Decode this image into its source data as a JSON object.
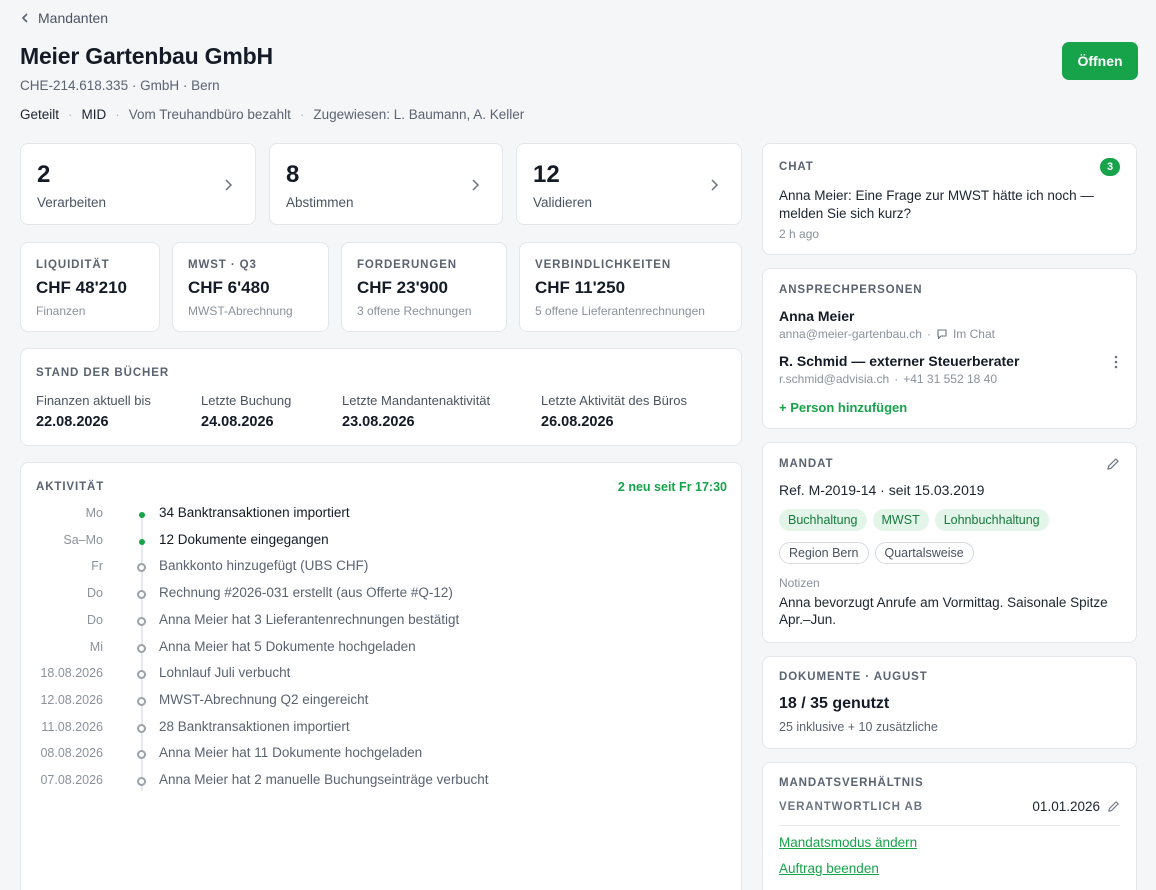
{
  "nav": {
    "back_label": "Mandanten"
  },
  "client": {
    "name": "Meier Gartenbau GmbH",
    "subtitle": "CHE-214.618.335 · GmbH · Bern",
    "meta": [
      "Geteilt",
      "MID",
      "Vom Treuhandbüro bezahlt",
      "Zugewiesen: L. Baumann, A. Keller"
    ],
    "open_label": "Öffnen"
  },
  "tasks": [
    {
      "count": "2",
      "label": "Verarbeiten"
    },
    {
      "count": "8",
      "label": "Abstimmen"
    },
    {
      "count": "12",
      "label": "Validieren"
    }
  ],
  "kpis": [
    {
      "caption": "LIQUIDITÄT",
      "value": "CHF 48'210",
      "sub": "Finanzen"
    },
    {
      "caption": "MWST · Q3",
      "value": "CHF 6'480",
      "sub": "MWST-Abrechnung"
    },
    {
      "caption": "FORDERUNGEN",
      "value": "CHF 23'900",
      "sub": "3 offene Rechnungen"
    },
    {
      "caption": "VERBINDLICHKEITEN",
      "value": "CHF 11'250",
      "sub": "5 offene Lieferantenrechnungen"
    }
  ],
  "books": {
    "caption": "STAND DER BÜCHER",
    "columns": [
      {
        "label": "Finanzen aktuell bis",
        "value": "22.08.2026"
      },
      {
        "label": "Letzte Buchung",
        "value": "24.08.2026"
      },
      {
        "label": "Letzte Mandantenaktivität",
        "value": "23.08.2026"
      },
      {
        "label": "Letzte Aktivität des Büros",
        "value": "26.08.2026"
      }
    ]
  },
  "activity": {
    "caption": "AKTIVITÄT",
    "new_label": "2 neu seit Fr 17:30",
    "items": [
      {
        "day": "Mo",
        "text": "34 Banktransaktionen importiert",
        "new": true
      },
      {
        "day": "Sa–Mo",
        "text": "12 Dokumente eingegangen",
        "new": true
      },
      {
        "day": "Fr",
        "text": "Bankkonto hinzugefügt (UBS CHF)",
        "new": false
      },
      {
        "day": "Do",
        "text": "Rechnung #2026-031 erstellt (aus Offerte #Q-12)",
        "new": false
      },
      {
        "day": "Do",
        "text": "Anna Meier hat 3 Lieferantenrechnungen bestätigt",
        "new": false
      },
      {
        "day": "Mi",
        "text": "Anna Meier hat 5 Dokumente hochgeladen",
        "new": false
      },
      {
        "day": "18.08.2026",
        "text": "Lohnlauf Juli verbucht",
        "new": false
      },
      {
        "day": "12.08.2026",
        "text": "MWST-Abrechnung Q2 eingereicht",
        "new": false
      },
      {
        "day": "11.08.2026",
        "text": "28 Banktransaktionen importiert",
        "new": false
      },
      {
        "day": "08.08.2026",
        "text": "Anna Meier hat 11 Dokumente hochgeladen",
        "new": false
      },
      {
        "day": "07.08.2026",
        "text": "Anna Meier hat 2 manuelle Buchungseinträge verbucht",
        "new": false
      }
    ]
  },
  "chat": {
    "caption": "CHAT",
    "badge": "3",
    "message": "Anna Meier: Eine Frage zur MWST hätte ich noch — melden Sie sich kurz?",
    "time": "2 h ago"
  },
  "contacts": {
    "caption": "ANSPRECHPERSONEN",
    "people": [
      {
        "name": "Anna Meier",
        "email": "anna@meier-gartenbau.ch",
        "extra": "Im Chat"
      },
      {
        "name": "R. Schmid — externer Steuerberater",
        "email": "r.schmid@advisia.ch",
        "extra": "+41 31 552 18 40"
      }
    ],
    "add_label": "+ Person hinzufügen"
  },
  "mandate": {
    "caption": "MANDAT",
    "ref": "Ref. M-2019-14 · seit 15.03.2019",
    "services": [
      "Buchhaltung",
      "MWST",
      "Lohnbuchhaltung"
    ],
    "attributes": [
      "Region Bern",
      "Quartalsweise"
    ],
    "notes_label": "Notizen",
    "notes": "Anna bevorzugt Anrufe am Vormittag. Saisonale Spitze Apr.–Jun."
  },
  "documents": {
    "caption": "DOKUMENTE · AUGUST",
    "usage": "18 / 35 genutzt",
    "sub": "25 inklusive + 10 zusätzliche"
  },
  "relationship": {
    "caption": "MANDATSVERHÄLTNIS",
    "responsible_label": "VERANTWORTLICH AB",
    "responsible_value": "01.01.2026",
    "change_mode_label": "Mandatsmodus ändern",
    "end_label": "Auftrag beenden"
  },
  "colors": {
    "accent": "#16a34a",
    "accent_soft": "#e3f4e8"
  }
}
